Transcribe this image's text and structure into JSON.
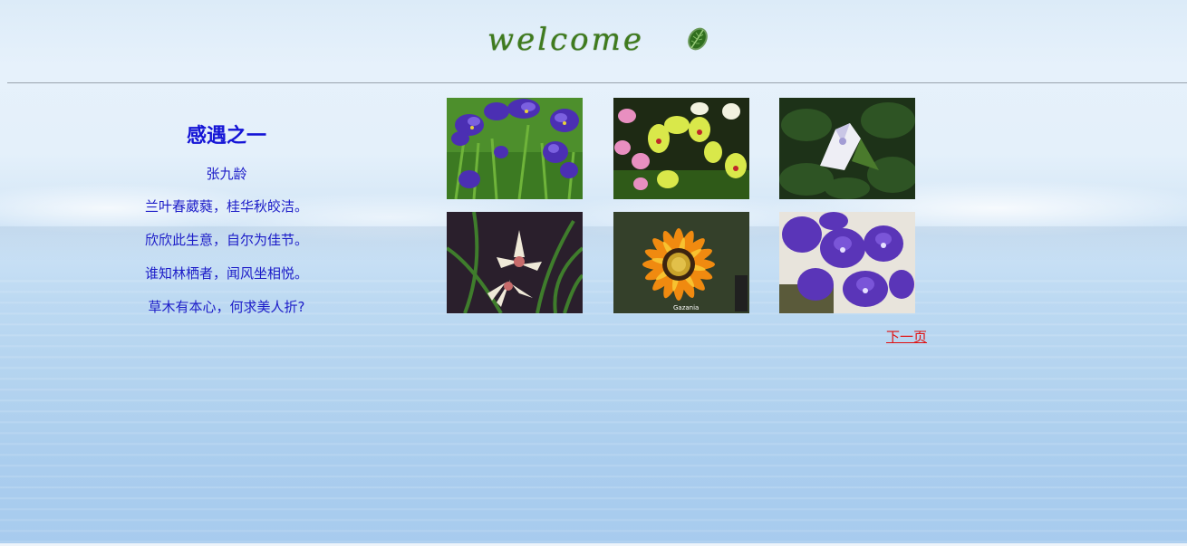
{
  "header": {
    "welcome_text": "welcome",
    "logo_icon": "leaf-icon"
  },
  "poem": {
    "title": "感遇之一",
    "author": "张九龄",
    "lines": [
      "兰叶春葳蕤，桂华秋皎洁。",
      "欣欣此生意，自尔为佳节。",
      "谁知林栖者，闻风坐相悦。",
      "草木有本心，何求美人折?"
    ]
  },
  "gallery": {
    "images": [
      {
        "subject": "purple iris flowers"
      },
      {
        "subject": "yellow and pink orchids"
      },
      {
        "subject": "white trumpet flower"
      },
      {
        "subject": "white orchid with green leaves"
      },
      {
        "subject": "orange gazania flower",
        "caption": "Gazania"
      },
      {
        "subject": "purple orchids"
      }
    ]
  },
  "pagination": {
    "next_label": "下一页"
  },
  "colors": {
    "poem_text": "#1c1cc8",
    "link": "#e01010",
    "logo_green": "#3f7b1e"
  }
}
